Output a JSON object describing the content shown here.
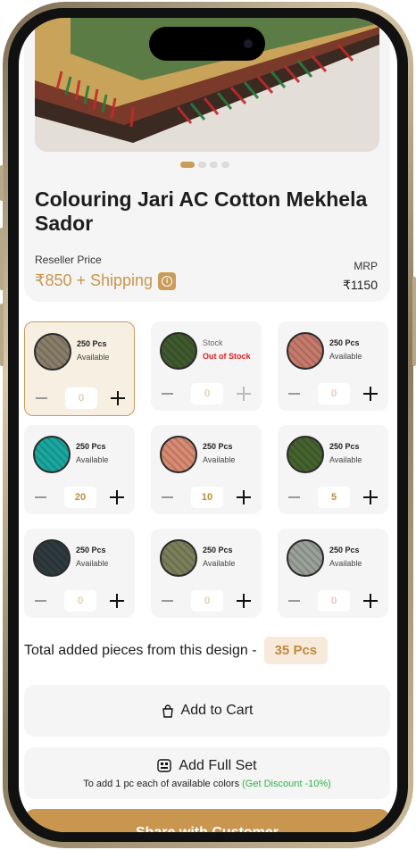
{
  "product": {
    "title": "Colouring Jari AC Cotton Mekhela Sador",
    "image_alt": "product-image",
    "carousel": {
      "count": 4,
      "active": 0
    },
    "reseller_label": "Reseller Price",
    "reseller_price": "₹850 + Shipping",
    "mrp_label": "MRP",
    "mrp_value": "₹1150"
  },
  "variants": [
    {
      "title": "250 Pcs",
      "sub": "Available",
      "qty": "0",
      "color": "#8a7e6a",
      "selected": true,
      "oos": false
    },
    {
      "title": "Stock",
      "sub": "Out of Stock",
      "qty": "0",
      "color": "#3f5a2e",
      "selected": false,
      "oos": true
    },
    {
      "title": "250 Pcs",
      "sub": "Available",
      "qty": "0",
      "color": "#c67a6c",
      "selected": false,
      "oos": false
    },
    {
      "title": "250 Pcs",
      "sub": "Available",
      "qty": "20",
      "color": "#1aa7a0",
      "selected": false,
      "oos": false
    },
    {
      "title": "250 Pcs",
      "sub": "Available",
      "qty": "10",
      "color": "#d88a72",
      "selected": false,
      "oos": false
    },
    {
      "title": "250 Pcs",
      "sub": "Available",
      "qty": "5",
      "color": "#46622e",
      "selected": false,
      "oos": false
    },
    {
      "title": "250 Pcs",
      "sub": "Available",
      "qty": "0",
      "color": "#2e3a3e",
      "selected": false,
      "oos": false
    },
    {
      "title": "250 Pcs",
      "sub": "Available",
      "qty": "0",
      "color": "#7b7f5a",
      "selected": false,
      "oos": false
    },
    {
      "title": "250 Pcs",
      "sub": "Available",
      "qty": "0",
      "color": "#9aa09a",
      "selected": false,
      "oos": false
    }
  ],
  "total": {
    "label": "Total added pieces from this design -",
    "value": "35 Pcs"
  },
  "actions": {
    "add_to_cart": "Add to Cart",
    "add_full_set": "Add Full Set",
    "full_set_note": "To add 1 pc each of available colors",
    "discount_note": "(Get Discount -10%)",
    "share": "Share with Customer"
  },
  "colors": {
    "accent": "#c99c5a",
    "danger": "#e11d1d",
    "success": "#2bb34b"
  }
}
